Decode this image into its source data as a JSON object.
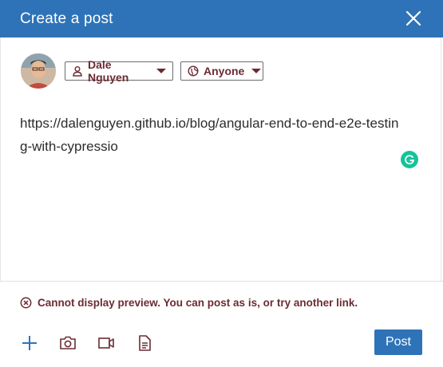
{
  "header": {
    "title": "Create a post",
    "close_icon": "close-icon"
  },
  "author": {
    "name": "Dale Nguyen",
    "icon": "person-icon"
  },
  "visibility": {
    "value": "Anyone",
    "icon": "globe-icon"
  },
  "editor": {
    "text": "https://dalenguyen.github.io/blog/angular-end-to-end-e2e-testing-with-cypressio"
  },
  "preview": {
    "message": "Cannot display preview. You can post as is, or try another link.",
    "icon": "error-circle-icon"
  },
  "toolbar": {
    "icons": [
      "add-icon",
      "camera-icon",
      "video-icon",
      "document-icon"
    ],
    "post_label": "Post"
  },
  "colors": {
    "brand": "#2e73b8",
    "accent_text": "#6b2b33",
    "grammarly": "#15c39a"
  }
}
